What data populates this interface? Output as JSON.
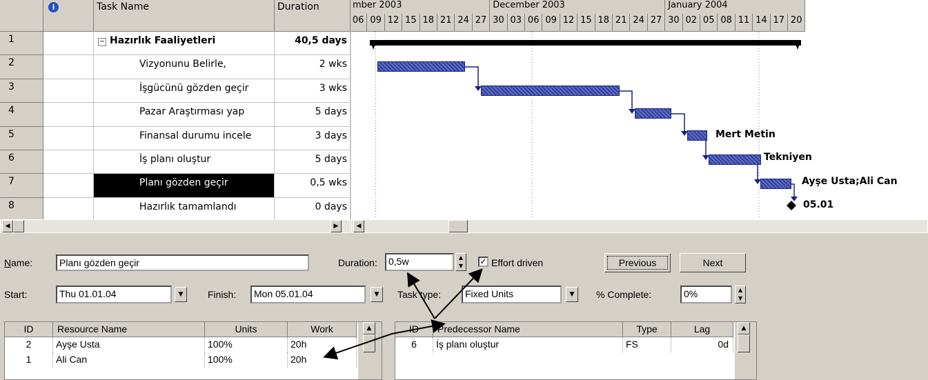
{
  "sheet": {
    "headers": {
      "info": "i",
      "task_name": "Task Name",
      "duration": "Duration"
    },
    "rows": [
      {
        "id": "1",
        "name": "Hazırlık Faaliyetleri",
        "duration": "40,5 days",
        "summary": true
      },
      {
        "id": "2",
        "name": "Vizyonunu Belirle,",
        "duration": "2 wks"
      },
      {
        "id": "3",
        "name": "İşgücünü gözden geçir",
        "duration": "3 wks"
      },
      {
        "id": "4",
        "name": "Pazar Araştırması yap",
        "duration": "5 days"
      },
      {
        "id": "5",
        "name": "Finansal durumu incele",
        "duration": "3 days"
      },
      {
        "id": "6",
        "name": "İş planı oluştur",
        "duration": "5 days"
      },
      {
        "id": "7",
        "name": "Planı gözden geçir",
        "duration": "0,5 wks"
      },
      {
        "id": "8",
        "name": "Hazırlık tamamlandı",
        "duration": "0 days"
      }
    ],
    "collapse_glyph": "−"
  },
  "gantt": {
    "months": [
      "mber 2003",
      "December 2003",
      "January 2004"
    ],
    "days": [
      "06",
      "09",
      "12",
      "15",
      "18",
      "21",
      "24",
      "27",
      "30",
      "03",
      "06",
      "09",
      "12",
      "15",
      "18",
      "21",
      "24",
      "27",
      "30",
      "02",
      "05",
      "08",
      "11",
      "14",
      "17",
      "20"
    ],
    "labels": {
      "row5": "Mert Metin",
      "row6": "Tekniyen",
      "row7": "Ayşe Usta;Ali Can",
      "row8": "05.01"
    }
  },
  "form": {
    "name_label": "Name:",
    "name_value": "Planı gözden geçir",
    "duration_label": "Duration:",
    "duration_value": "0,5w",
    "effort_label": "Effort driven",
    "effort_checked": true,
    "previous_label": "Previous",
    "next_label": "Next",
    "start_label": "Start:",
    "start_value": "Thu 01.01.04",
    "finish_label": "Finish:",
    "finish_value": "Mon 05.01.04",
    "task_type_label": "Task type:",
    "task_type_value": "Fixed Units",
    "complete_label": "% Complete:",
    "complete_value": "0%"
  },
  "resources": {
    "headers": {
      "id": "ID",
      "name": "Resource Name",
      "units": "Units",
      "work": "Work"
    },
    "rows": [
      {
        "id": "2",
        "name": "Ayşe Usta",
        "units": "100%",
        "work": "20h"
      },
      {
        "id": "1",
        "name": "Ali Can",
        "units": "100%",
        "work": "20h"
      }
    ]
  },
  "predecessors": {
    "headers": {
      "id": "ID",
      "name": "Predecessor Name",
      "type": "Type",
      "lag": "Lag"
    },
    "rows": [
      {
        "id": "6",
        "name": "İş planı oluştur",
        "type": "FS",
        "lag": "0d"
      }
    ]
  },
  "colors": {
    "bar": "#3040a0",
    "chrome": "#d4d0c8"
  }
}
